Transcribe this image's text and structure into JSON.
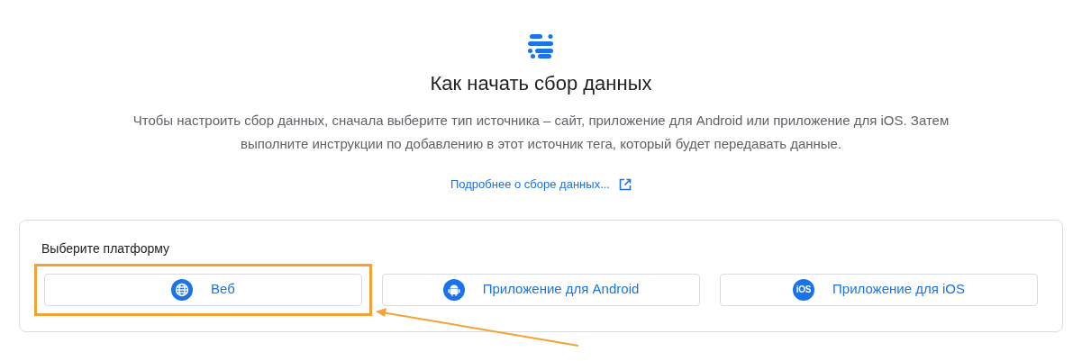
{
  "title": "Как начать сбор данных",
  "description": "Чтобы настроить сбор данных, сначала выберите тип источника – сайт, приложение для Android или приложение для iOS. Затем выполните инструкции по добавлению в этот источник тега, который будет передавать данные.",
  "link": "Подробнее о сборе данных...",
  "platform_card": {
    "label": "Выберите платформу",
    "platforms": [
      {
        "kind": "web",
        "label": "Веб",
        "selected": true
      },
      {
        "kind": "android",
        "label": "Приложение для Android",
        "selected": false
      },
      {
        "kind": "ios",
        "label": "Приложение для iOS",
        "icon_text": "iOS",
        "selected": false
      }
    ]
  }
}
